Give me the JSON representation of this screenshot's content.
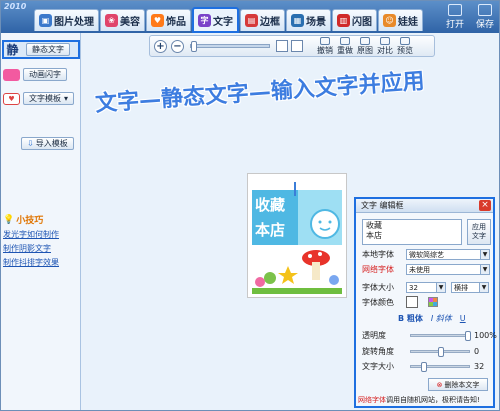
{
  "app": {
    "logo": "2010"
  },
  "tabs": [
    {
      "label": "图片处理",
      "icon_color": "#3b79cc"
    },
    {
      "label": "美容",
      "icon_color": "#e0446a"
    },
    {
      "label": "饰品",
      "icon_color": "#ff7a1a"
    },
    {
      "label": "文字",
      "icon_color": "#7a43c9",
      "active": true
    },
    {
      "label": "边框",
      "icon_color": "#d63a3a"
    },
    {
      "label": "场景",
      "icon_color": "#2a6fb0"
    },
    {
      "label": "闪图",
      "icon_color": "#d02a2a"
    },
    {
      "label": "娃娃",
      "icon_color": "#e88a2a"
    }
  ],
  "top_right": {
    "open": "打开",
    "save": "保存"
  },
  "toolbar": {
    "undo": "撤销",
    "redo": "重做",
    "original": "原图",
    "compare": "对比",
    "preview": "预览",
    "zoom_in": "+",
    "zoom_out": "−"
  },
  "sidebar": {
    "static_char": "静",
    "static_text": "静态文字",
    "animated_text": "动画闪字",
    "template": "文字模板",
    "import_template": "导入模板",
    "tips_title": "小技巧",
    "tips": [
      "发光字如何制作",
      "制作阴影文字",
      "制作抖排字效果"
    ]
  },
  "caption": "文字—静态文字—输入文字并应用",
  "editor": {
    "title": "文字 编辑框",
    "close": "×",
    "text_value": "收藏\n本店",
    "apply": [
      "应用",
      "文字"
    ],
    "local_font_label": "本地字体",
    "local_font_value": "微软简综艺",
    "web_font_label": "网络字体",
    "web_font_value": "未使用",
    "size_label": "字体大小",
    "size_value": "32",
    "orientation_value": "横排",
    "color_label": "字体颜色",
    "bold": "B 粗体",
    "italic": "I 斜体",
    "underline": "U",
    "opacity_label": "透明度",
    "opacity_value": "100%",
    "rotate_label": "旋转角度",
    "rotate_value": "0",
    "text_size_label": "文字大小",
    "text_size_value": "32",
    "delete": "删除本文字",
    "footer_red": "网络字体",
    "footer_rest": "调用自随机网站，极积请告知!"
  },
  "canvas_text": {
    "line1": "收藏",
    "line2": "本店"
  },
  "colors": {
    "accent": "#1e6fe0",
    "caption": "#3d7de0",
    "close_red": "#d93a2b"
  }
}
